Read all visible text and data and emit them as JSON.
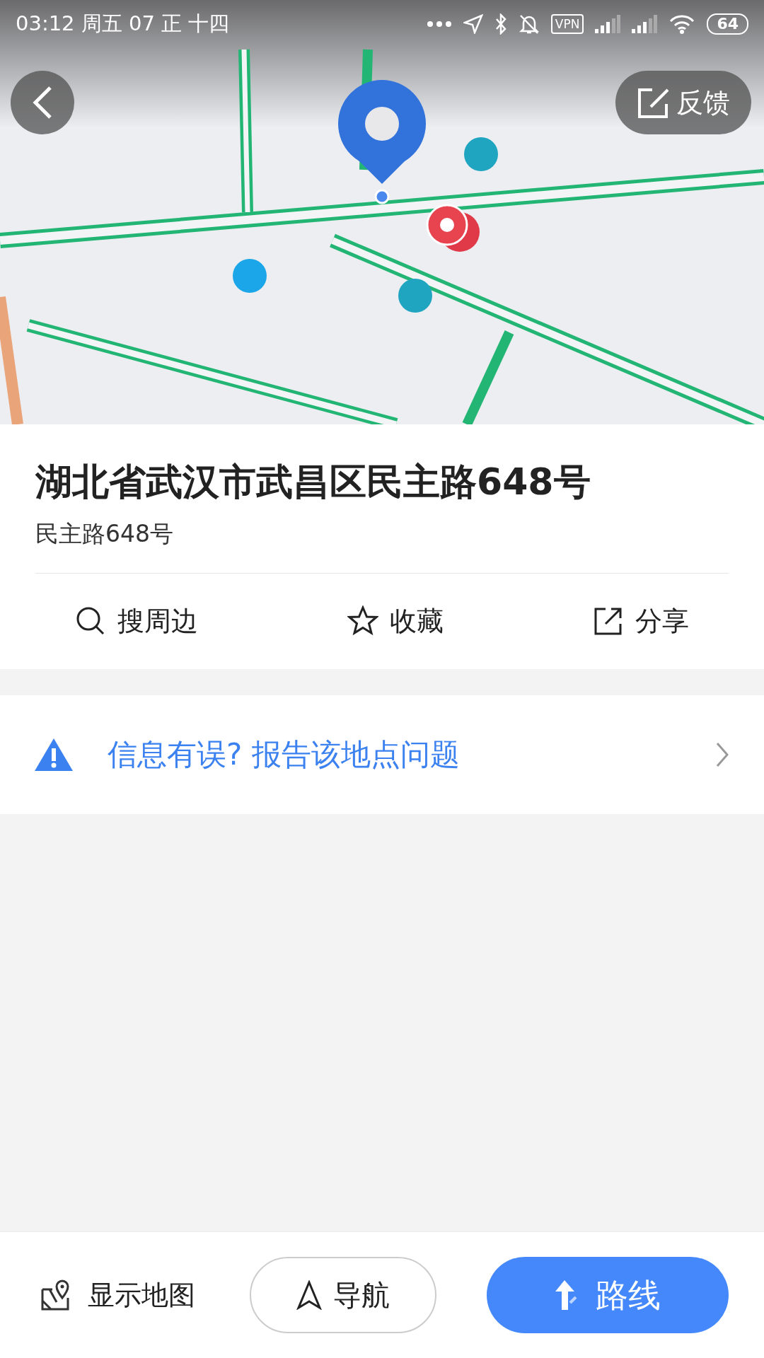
{
  "status_bar": {
    "time": "03:12 周五 07 正 十四",
    "vpn": "VPN",
    "battery": "64"
  },
  "top_buttons": {
    "feedback": "反馈"
  },
  "place": {
    "title": "湖北省武汉市武昌区民主路648号",
    "subtitle": "民主路648号"
  },
  "actions": [
    {
      "kind": "search",
      "label": "搜周边"
    },
    {
      "kind": "star",
      "label": "收藏"
    },
    {
      "kind": "share",
      "label": "分享"
    }
  ],
  "report": {
    "text": "信息有误? 报告该地点问题"
  },
  "bottom_bar": {
    "show_map": "显示地图",
    "navigate": "导航",
    "route": "路线"
  }
}
